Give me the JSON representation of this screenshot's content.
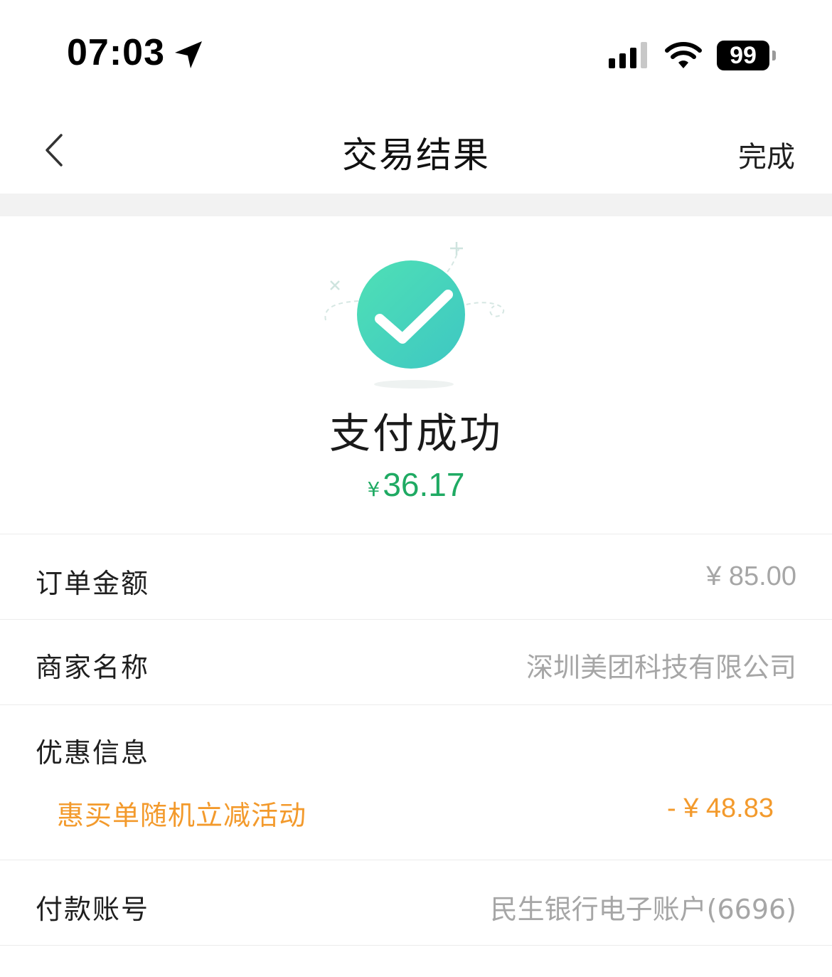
{
  "status_bar": {
    "time": "07:03",
    "battery": "99",
    "icons": [
      "location-arrow-icon",
      "signal-icon",
      "wifi-icon",
      "battery-icon"
    ]
  },
  "nav": {
    "title": "交易结果",
    "done_label": "完成",
    "back_icon": "chevron-left-icon"
  },
  "result": {
    "status_icon": "check-circle-icon",
    "status_text": "支付成功",
    "currency": "¥",
    "amount": "36.17"
  },
  "details": {
    "order_amount": {
      "label": "订单金额",
      "value": "¥ 85.00"
    },
    "merchant": {
      "label": "商家名称",
      "value": "深圳美团科技有限公司"
    },
    "discount": {
      "label": "优惠信息",
      "item_name": "惠买单随机立减活动",
      "item_value": "- ¥ 48.83"
    },
    "payment_account": {
      "label": "付款账号",
      "value": "民生银行电子账户(6696)"
    }
  },
  "colors": {
    "success_green": "#1faa63",
    "promo_orange": "#f39a2c",
    "muted_gray": "#a6a6a6",
    "check_gradient_start": "#4fe0b5",
    "check_gradient_end": "#3ec7c3"
  }
}
